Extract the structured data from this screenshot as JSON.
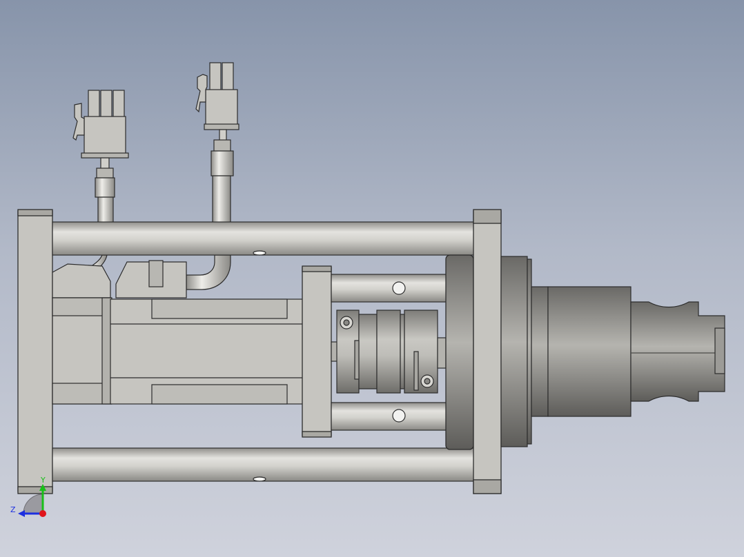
{
  "viewport": {
    "background_top": "#8794aa",
    "background_bottom": "#cfd2dc"
  },
  "model": {
    "part_color": "#c6c5c0",
    "edge_color": "#2c2c2c"
  },
  "triad": {
    "y_label": "Y",
    "z_label": "Z",
    "y_color": "#18c018",
    "z_color": "#1c2fe0",
    "x_color": "#e0141c"
  }
}
